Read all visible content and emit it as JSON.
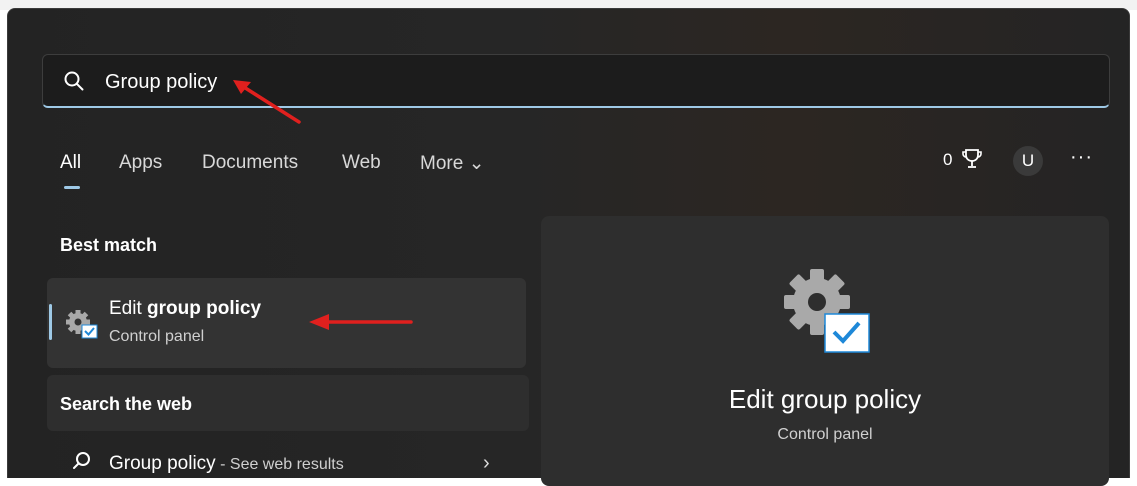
{
  "search": {
    "value": "Group policy",
    "placeholder": ""
  },
  "tabs": [
    {
      "label": "All"
    },
    {
      "label": "Apps"
    },
    {
      "label": "Documents"
    },
    {
      "label": "Web"
    },
    {
      "label": "More ⌄"
    }
  ],
  "header_tools": {
    "points": "0",
    "avatar_letter": "U",
    "more": "···"
  },
  "best_match": {
    "section": "Best match",
    "title_prefix": "Edit ",
    "title_bold": "group policy",
    "subtitle": "Control panel"
  },
  "web": {
    "section": "Search the web",
    "query": "Group policy",
    "suffix": " - See web results"
  },
  "preview": {
    "title": "Edit group policy",
    "subtitle": "Control panel"
  },
  "colors": {
    "accent": "#9ec9e6",
    "annotation_arrow": "#e0201e",
    "panel": "#262626"
  }
}
